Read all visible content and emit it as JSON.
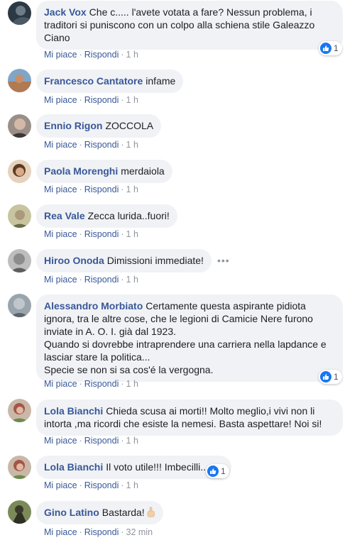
{
  "ui": {
    "like_label": "Mi piace",
    "reply_label": "Rispondi",
    "separator": "·"
  },
  "comments": [
    {
      "author": "Jack Vox",
      "lines": [
        "Che c..... l'avete votata a fare? Nessun problema, i",
        "traditori si puniscono con un colpo alla schiena stile Galeazzo",
        "Ciano"
      ],
      "time": "1 h",
      "reactions": "1",
      "avatar_color": "#2b3945"
    },
    {
      "author": "Francesco Cantatore",
      "lines": [
        "infame"
      ],
      "time": "1 h",
      "avatar_color": "#b07a52"
    },
    {
      "author": "Ennio Rigon",
      "lines": [
        "ZOCCOLA"
      ],
      "time": "1 h",
      "avatar_color": "#5c5450"
    },
    {
      "author": "Paola Morenghi",
      "lines": [
        "merdaiola"
      ],
      "time": "1 h",
      "avatar_color": "#7a5a3c"
    },
    {
      "author": "Rea Vale",
      "lines": [
        "Zecca lurida..fuori!"
      ],
      "time": "1 h",
      "avatar_color": "#8a8f6a"
    },
    {
      "author": "Hiroo Onoda",
      "lines": [
        "Dimissioni immediate!"
      ],
      "time": "1 h",
      "avatar_color": "#8c8c8c"
    },
    {
      "author": "Alessandro Morbiato",
      "lines": [
        "Certamente questa aspirante pidiota",
        "ignora, tra le altre cose, che le legioni di Camicie Nere furono",
        "inviate in A. O. I. già dal 1923.",
        "Quando si dovrebbe intraprendere una carriera nella lapdance e",
        "lasciar stare la politica...",
        "Specie se non si sa cos'é la vergogna."
      ],
      "time": "1 h",
      "reactions": "1",
      "avatar_color": "#7f8890"
    },
    {
      "author": "Lola Bianchi",
      "lines": [
        "Chieda scusa ai morti!! Molto meglio,i vivi non li",
        "intorta ,ma ricordi che esiste la nemesi. Basta aspettare! Noi si!"
      ],
      "time": "1 h",
      "avatar_color": "#a4554a"
    },
    {
      "author": "Lola Bianchi",
      "lines": [
        "Il voto utile!!! Imbecilli.."
      ],
      "time": "1 h",
      "reactions": "1",
      "avatar_color": "#a4554a"
    },
    {
      "author": "Gino Latino",
      "lines": [
        "Bastarda!"
      ],
      "time": "32 min",
      "avatar_color": "#4f5a3a"
    }
  ]
}
